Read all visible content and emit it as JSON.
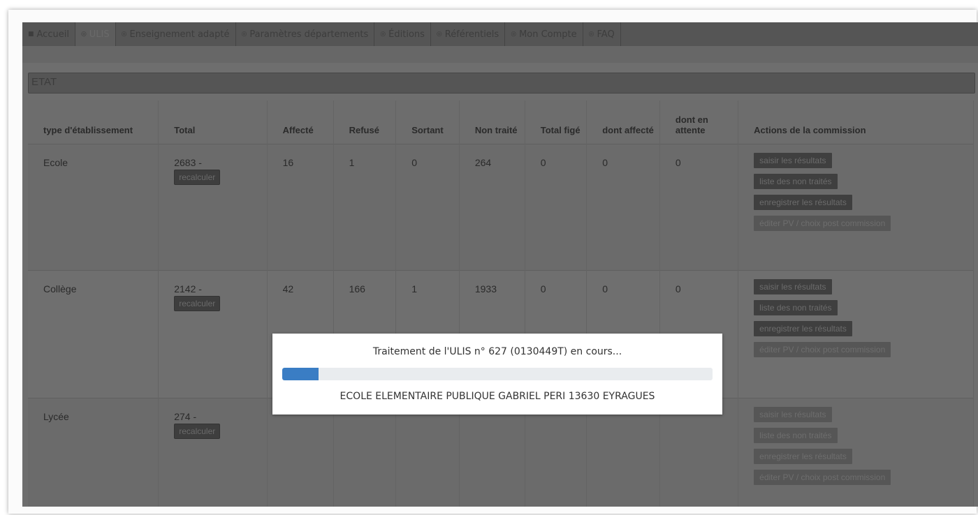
{
  "nav": {
    "items": [
      {
        "label": "Accueil",
        "active": false,
        "icon": "home-icon"
      },
      {
        "label": "ULIS",
        "active": true,
        "icon": "circle-icon"
      },
      {
        "label": "Enseignement adapté",
        "active": false,
        "icon": "circle-icon"
      },
      {
        "label": "Paramètres départements",
        "active": false,
        "icon": "circle-icon"
      },
      {
        "label": "Éditions",
        "active": false,
        "icon": "circle-icon"
      },
      {
        "label": "Référentiels",
        "active": false,
        "icon": "circle-icon"
      },
      {
        "label": "Mon Compte",
        "active": false,
        "icon": "circle-icon"
      },
      {
        "label": "FAQ",
        "active": false,
        "icon": "circle-icon"
      }
    ]
  },
  "panel": {
    "title": "ETAT"
  },
  "table": {
    "headers": {
      "type": "type d'établissement",
      "total": "Total",
      "affecte": "Affecté",
      "refuse": "Refusé",
      "sortant": "Sortant",
      "non_traite": "Non traité",
      "total_fige": "Total figé",
      "dont_affecte": "dont affecté",
      "dont_attente": "dont en attente",
      "actions": "Actions de la commission"
    },
    "recalc_label": "recalculer",
    "actions": {
      "saisir": "saisir les résultats",
      "liste": "liste des non traités",
      "enregistrer": "enregistrer les résultats",
      "editer": "éditer PV / choix post commission"
    },
    "rows": [
      {
        "type": "Ecole",
        "total": "2683 -",
        "affecte": "16",
        "refuse": "1",
        "sortant": "0",
        "non_traite": "264",
        "total_fige": "0",
        "dont_affecte": "0",
        "dont_attente": "0"
      },
      {
        "type": "Collège",
        "total": "2142 -",
        "affecte": "42",
        "refuse": "166",
        "sortant": "1",
        "non_traite": "1933",
        "total_fige": "0",
        "dont_affecte": "0",
        "dont_attente": "0"
      },
      {
        "type": "Lycée",
        "total": "274 -",
        "affecte": "",
        "refuse": "",
        "sortant": "",
        "non_traite": "",
        "total_fige": "",
        "dont_affecte": "",
        "dont_attente": ""
      }
    ]
  },
  "progress": {
    "title": "Traitement de l'ULIS n° 627 (0130449T) en cours...",
    "fraction": 0.085,
    "school": "ECOLE ELEMENTAIRE PUBLIQUE GABRIEL PERI 13630 EYRAGUES",
    "color": "#3a7dc4"
  }
}
